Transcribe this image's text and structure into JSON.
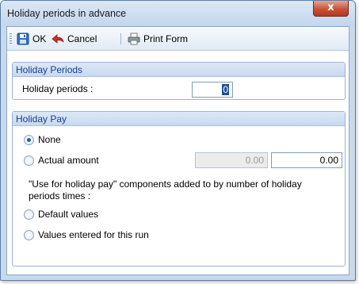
{
  "window": {
    "title": "Holiday periods in advance",
    "close_glyph": "x"
  },
  "toolbar": {
    "ok_label": "OK",
    "cancel_label": "Cancel",
    "print_label": "Print Form",
    "ok_icon": "save-icon",
    "cancel_icon": "back-arrow-icon",
    "print_icon": "print-form-icon"
  },
  "holiday_periods_group": {
    "title": "Holiday Periods",
    "field_label": "Holiday periods :",
    "value": "0"
  },
  "holiday_pay_group": {
    "title": "Holiday Pay",
    "options": [
      {
        "label": "None",
        "checked": true
      },
      {
        "label": "Actual amount",
        "checked": false
      }
    ],
    "actual_amount_disabled_value": "0.00",
    "actual_amount_value": "0.00",
    "note": "\"Use for holiday pay\" components added to by number of holiday periods times :",
    "sub_options": [
      {
        "label": "Default values",
        "checked": false
      },
      {
        "label": "Values entered for this run",
        "checked": false
      }
    ]
  },
  "colors": {
    "group_header_text": "#15428b",
    "frame": "#c9d9ec",
    "close_button": "#c7533a"
  }
}
